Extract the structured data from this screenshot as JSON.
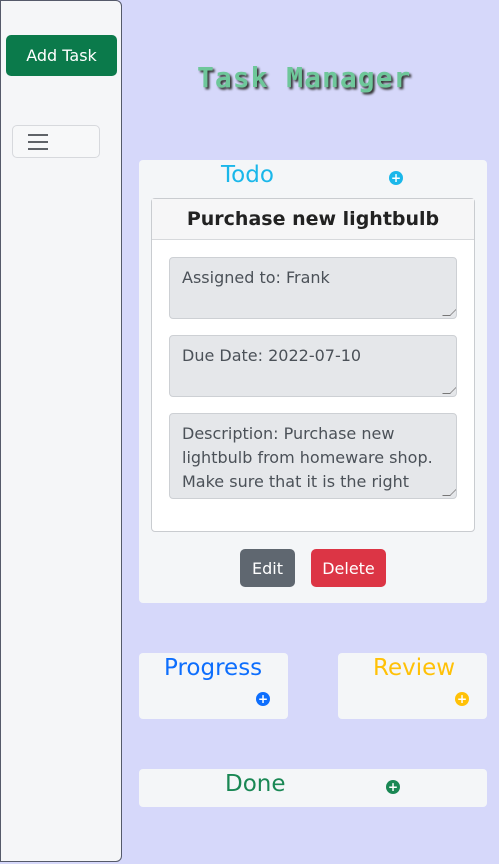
{
  "sidebar": {
    "add_task_label": "Add Task",
    "menu_icon": "hamburger-menu-icon"
  },
  "header": {
    "title": "Task Manager"
  },
  "columns": {
    "todo": {
      "title": "Todo",
      "add_icon": "plus-circle-icon",
      "color": "#1ab7ea"
    },
    "progress": {
      "title": "Progress",
      "add_icon": "plus-circle-icon",
      "color": "#0d6efd"
    },
    "review": {
      "title": "Review",
      "add_icon": "plus-circle-icon",
      "color": "#ffc107"
    },
    "done": {
      "title": "Done",
      "add_icon": "plus-circle-icon",
      "color": "#198754"
    }
  },
  "task": {
    "title": "Purchase new lightbulb",
    "assigned": "Assigned to:  Frank",
    "due": "Due Date: 2022-07-10",
    "description": "Description: Purchase new lightbulb from homeware shop. Make sure that it is the right size and type.",
    "edit_label": "Edit",
    "delete_label": "Delete"
  },
  "colors": {
    "background": "#d6d8fa",
    "add_task_button": "#0b7a4b",
    "edit_button": "#5f6770",
    "delete_button": "#dc3545"
  }
}
